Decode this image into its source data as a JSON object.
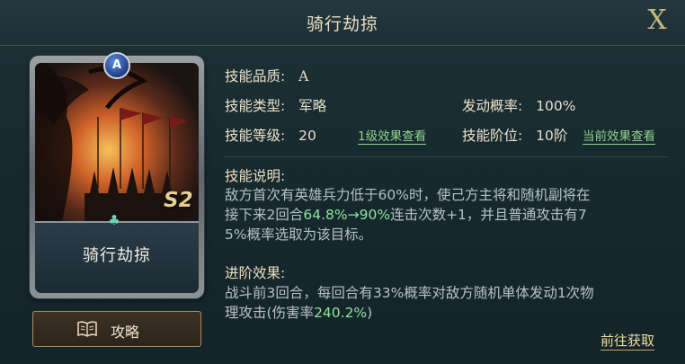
{
  "header": {
    "title": "骑行劫掠",
    "close_label": "X"
  },
  "card": {
    "name": "骑行劫掠",
    "grade_badge": "A",
    "season_tag": "S2"
  },
  "guide_button": {
    "label": "攻略",
    "icon": "book-icon"
  },
  "info": {
    "quality_label": "技能品质:",
    "quality_value": "A",
    "type_label": "技能类型:",
    "type_value": "军略",
    "rate_label": "发动概率:",
    "rate_value": "100%",
    "level_label": "技能等级:",
    "level_value": "20",
    "level_link": "1级效果查看",
    "rank_label": "技能阶位:",
    "rank_value": "10阶",
    "rank_link": "当前效果查看"
  },
  "description": {
    "title": "技能说明:",
    "line1": "敌方首次有英雄兵力低于60%时，使己方主将和随机副将在",
    "line2_prefix": "接下来2回合",
    "line2_hl": "64.8%→90%",
    "line2_suffix": "连击次数+1，并且普通攻击有7",
    "line3": "5%概率选取为该目标。"
  },
  "advanced": {
    "title": "进阶效果:",
    "line1": "战斗前3回合，每回合有33%概率对敌方随机单体发动1次物",
    "line2_prefix": "理攻击(伤害率",
    "line2_hl": "240.2%",
    "line2_suffix": ")"
  },
  "go_button": {
    "label": "前往获取"
  },
  "colors": {
    "accent_gold": "#cbb57e",
    "highlight_green": "#8be89b",
    "panel_bg": "#1b2f35"
  }
}
